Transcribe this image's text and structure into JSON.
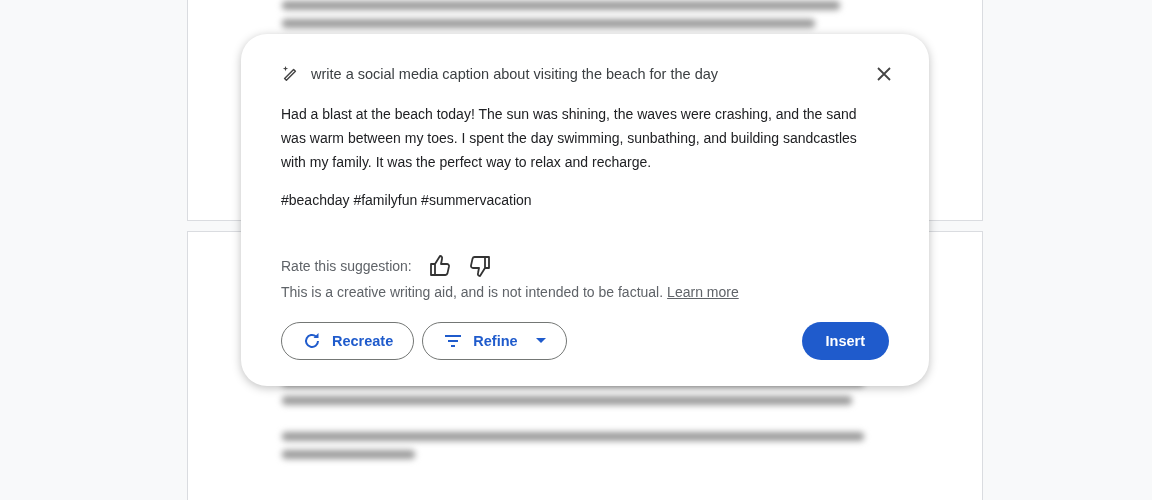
{
  "dialog": {
    "prompt": "write a social media caption about visiting the beach for the day",
    "paragraphs": [
      "Had a blast at the beach today! The sun was shining, the waves were crashing, and the sand was warm between my toes. I spent the day swimming, sunbathing, and building sandcastles with my family. It was the perfect way to relax and recharge.",
      "#beachday #familyfun #summervacation"
    ],
    "rating_label": "Rate this suggestion:",
    "disclaimer": "This is a creative writing aid, and is not intended to be factual.",
    "learn_more": "Learn more",
    "buttons": [
      {
        "label": "Recreate",
        "kind": "recreate"
      },
      {
        "label": "Refine",
        "kind": "refine"
      },
      {
        "label": "Insert",
        "kind": "insert"
      }
    ]
  }
}
